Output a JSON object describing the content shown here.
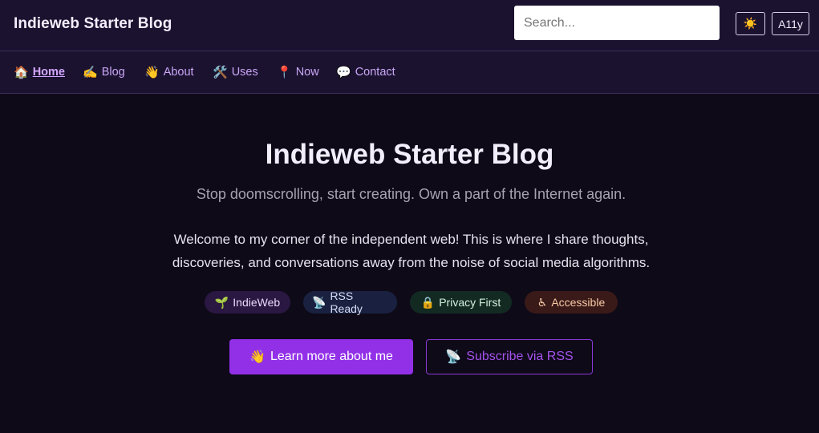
{
  "header": {
    "site_title": "Indieweb Starter Blog",
    "search_placeholder": "Search...",
    "theme_toggle_icon": "☀️",
    "a11y_label": "A11y"
  },
  "nav": {
    "items": [
      {
        "emoji": "🏠",
        "label": "Home",
        "active": true
      },
      {
        "emoji": "✍️",
        "label": "Blog"
      },
      {
        "emoji": "👋",
        "label": "About"
      },
      {
        "emoji": "🛠️",
        "label": "Uses"
      },
      {
        "emoji": "📍",
        "label": "Now"
      },
      {
        "emoji": "💬",
        "label": "Contact"
      }
    ]
  },
  "hero": {
    "title": "Indieweb Starter Blog",
    "subtitle": "Stop doomscrolling, start creating. Own a part of the Internet again.",
    "intro": "Welcome to my corner of the independent web! This is where I share thoughts, discoveries, and conversations away from the noise of social media algorithms."
  },
  "badges": [
    {
      "emoji": "🌱",
      "label": "IndieWeb"
    },
    {
      "emoji": "📡",
      "label": "RSS Ready"
    },
    {
      "emoji": "🔒",
      "label": "Privacy First"
    },
    {
      "emoji": "♿",
      "label": "Accessible"
    }
  ],
  "actions": {
    "primary": {
      "emoji": "👋",
      "label": "Learn more about me"
    },
    "secondary": {
      "emoji": "📡",
      "label": "Subscribe via RSS"
    }
  },
  "colors": {
    "background": "#0e0a18",
    "header_bg": "#1b1230",
    "accent": "#9230e8",
    "nav_link": "#c9a6f5"
  }
}
